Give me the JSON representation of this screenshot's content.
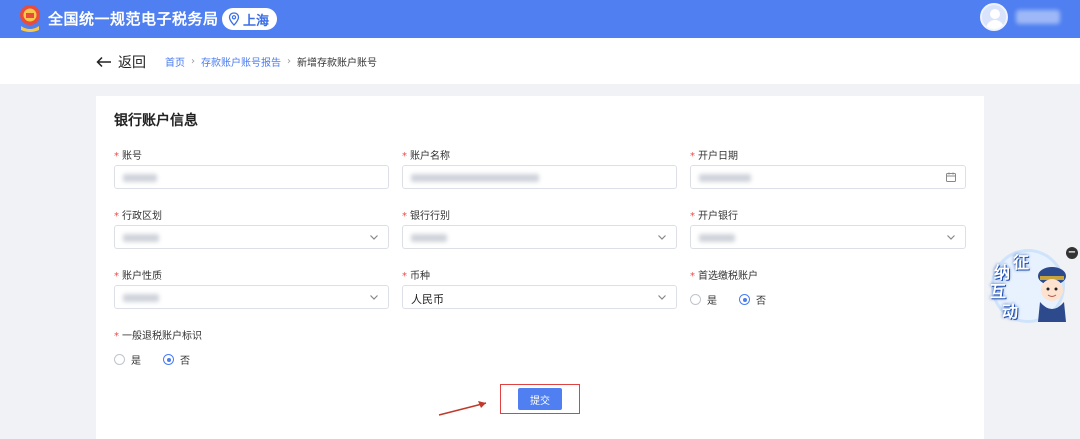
{
  "header": {
    "site_title": "全国统一规范电子税务局",
    "region": "上海",
    "brand_color": "#4f7ff0"
  },
  "nav": {
    "back_label": "返回",
    "breadcrumb": [
      "首页",
      "存款账户账号报告",
      "新增存款账户账号"
    ]
  },
  "form": {
    "title": "银行账户信息",
    "fields": [
      {
        "label": "账号",
        "type": "input",
        "required": true
      },
      {
        "label": "账户名称",
        "type": "input",
        "required": true
      },
      {
        "label": "开户日期",
        "type": "date",
        "required": true
      },
      {
        "label": "行政区划",
        "type": "select",
        "required": true
      },
      {
        "label": "银行行别",
        "type": "select",
        "required": true
      },
      {
        "label": "开户银行",
        "type": "select",
        "required": true
      },
      {
        "label": "账户性质",
        "type": "select",
        "required": true
      },
      {
        "label": "币种",
        "type": "select",
        "required": true,
        "value": "人民币"
      },
      {
        "label": "首选缴税账户",
        "type": "radio",
        "required": true,
        "options": [
          "是",
          "否"
        ],
        "selected": "否"
      },
      {
        "label": "一般退税账户标识",
        "type": "radio",
        "required": true,
        "options": [
          "是",
          "否"
        ],
        "selected": "否"
      }
    ],
    "submit_label": "提交"
  },
  "assistant": {
    "chars": [
      "征",
      "纳",
      "互",
      "动"
    ],
    "close_icon": "minus-icon"
  },
  "colors": {
    "accent": "#4a7cf3",
    "required": "#e34d4d",
    "highlight": "#e04141"
  }
}
